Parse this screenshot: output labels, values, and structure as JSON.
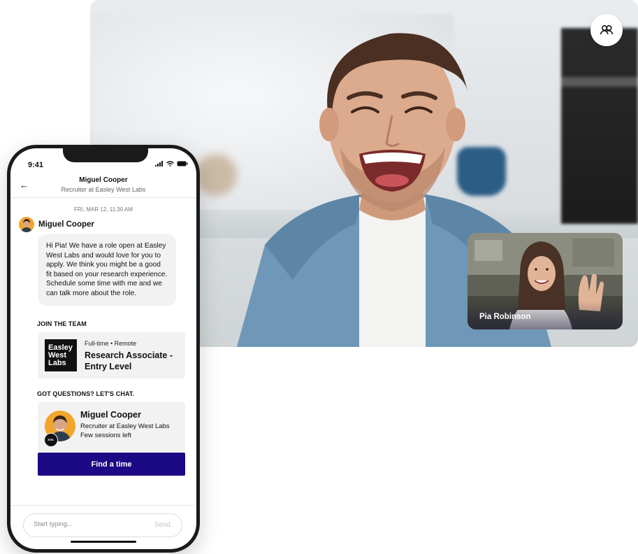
{
  "call": {
    "participants_icon": "people-icon",
    "self_view_name": "Pia Robinson"
  },
  "phone": {
    "status_time": "9:41",
    "header": {
      "name": "Miguel Cooper",
      "subtitle": "Recruiter at Easley West Labs"
    },
    "date_stamp": "FRI, MAR 12, 11:30 AM",
    "sender": "Miguel Cooper",
    "message": "Hi Pia! We have a role open at Easley West Labs and would love for you to apply. We think you might be a good fit based on your research experience. Schedule some time with me and we can talk more about the role.",
    "join_title": "JOIN THE TEAM",
    "job": {
      "logo_text": "Easley West Labs",
      "meta": "Full-time • Remote",
      "title": "Research Associate - Entry Level"
    },
    "chat_title": "GOT QUESTIONS? LET'S CHAT.",
    "recruiter": {
      "name": "Miguel Cooper",
      "role": "Recruiter at Easley West Labs",
      "sessions": "Few sessions left"
    },
    "cta_label": "Find a time",
    "composer": {
      "placeholder": "Start typing...",
      "send_label": "Send"
    }
  },
  "colors": {
    "cta": "#1c0985",
    "avatar_bg": "#f2a62b"
  }
}
